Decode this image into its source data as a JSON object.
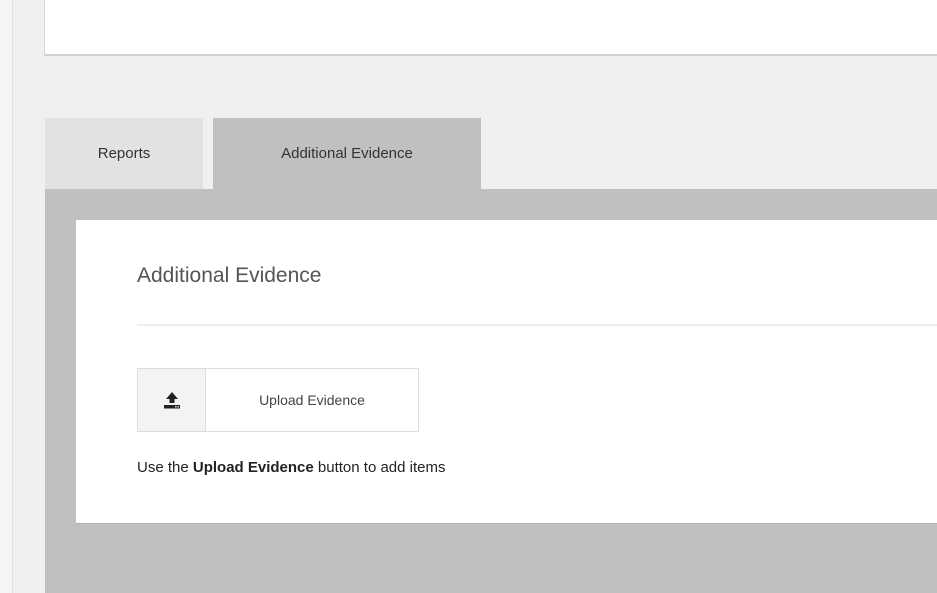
{
  "tabs": [
    {
      "label": "Reports",
      "active": false
    },
    {
      "label": "Additional Evidence",
      "active": true
    }
  ],
  "panel": {
    "title": "Additional Evidence",
    "upload_button": {
      "label": "Upload Evidence",
      "icon": "upload-icon"
    },
    "hint": {
      "prefix": "Use the ",
      "bold": "Upload Evidence",
      "suffix": " button to add items"
    }
  },
  "colors": {
    "page_background": "#f0f0f0",
    "tab_inactive": "#e2e2e2",
    "tab_active": "#c0c0c0",
    "content_background": "#c0c0c0",
    "panel_background": "#ffffff"
  }
}
